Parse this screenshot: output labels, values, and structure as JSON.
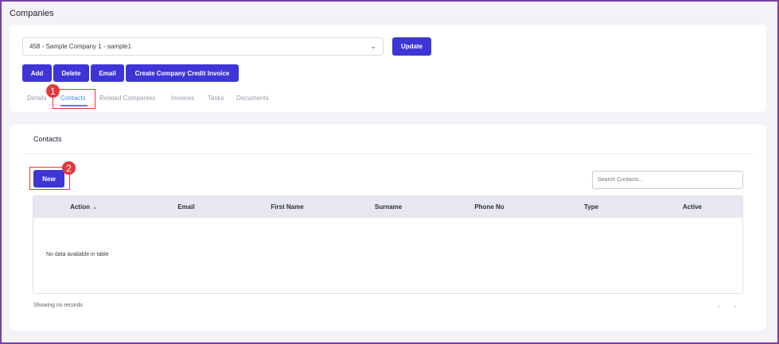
{
  "page": {
    "title": "Companies"
  },
  "company_select": {
    "value": "458 - Sample Company 1 - sample1"
  },
  "buttons": {
    "update": "Update",
    "add": "Add",
    "delete": "Delete",
    "email": "Email",
    "credit_invoice": "Create Company Credit Invoice",
    "new": "New"
  },
  "tabs": [
    {
      "label": "Details"
    },
    {
      "label": "Contacts",
      "active": true
    },
    {
      "label": "Related Companies"
    },
    {
      "label": "Invoices"
    },
    {
      "label": "Tasks"
    },
    {
      "label": "Documents"
    }
  ],
  "callouts": [
    "1",
    "2"
  ],
  "contacts": {
    "title": "Contacts",
    "search_placeholder": "Search Contacts...",
    "columns": [
      "Action",
      "Email",
      "First Name",
      "Surname",
      "Phone No",
      "Type",
      "Active"
    ],
    "empty_text": "No data available in table",
    "footer": "Showing no records",
    "pager": {
      "prev": "‹",
      "next": "›"
    }
  },
  "colors": {
    "primary": "#3d35d6",
    "active_tab": "#4a8bdf",
    "callout": "#e0393e",
    "frame": "#7b3fa0"
  }
}
